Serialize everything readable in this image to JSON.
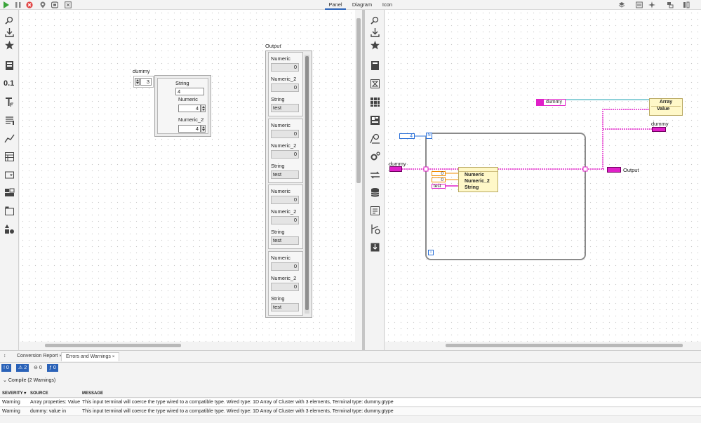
{
  "toolbar": {
    "tabs": [
      "Panel",
      "Diagram",
      "Icon"
    ],
    "active_tab": "Panel",
    "icons": [
      "run-icon",
      "pause-icon",
      "abort-icon",
      "breakpoint-icon",
      "probe-icon",
      "clean-up-icon"
    ]
  },
  "left_palette": {
    "icons": [
      "search-icon",
      "download-icon",
      "favorites-icon",
      "data-containers-icon",
      "numeric-icon",
      "string-icon",
      "list-icon",
      "graph-icon",
      "table-icon",
      "ring-icon",
      "boolean-icon",
      "tab-control-icon",
      "decorations-icon"
    ],
    "numeric_label": "0.1"
  },
  "right_palette": {
    "icons": [
      "search-icon",
      "download-icon",
      "favorites-icon",
      "data-icon",
      "timing-icon",
      "array-icon",
      "cluster-icon",
      "analysis-icon",
      "settings-icon",
      "comparison-icon",
      "database-icon",
      "report-icon",
      "connectivity-icon",
      "file-io-icon"
    ]
  },
  "panel": {
    "dummy": {
      "label": "dummy",
      "index": "3",
      "string_label": "String",
      "string_value": "4",
      "numeric_label": "Numeric",
      "numeric_value": "4",
      "numeric2_label": "Numeric_2",
      "numeric2_value": "4"
    },
    "output": {
      "label": "Output",
      "elements": [
        {
          "numeric_label": "Numeric",
          "numeric_value": "0",
          "numeric2_label": "Numeric_2",
          "numeric2_value": "0",
          "string_label": "String",
          "string_value": "test"
        },
        {
          "numeric_label": "Numeric",
          "numeric_value": "0",
          "numeric2_label": "Numeric_2",
          "numeric2_value": "0",
          "string_label": "String",
          "string_value": "test"
        },
        {
          "numeric_label": "Numeric",
          "numeric_value": "0",
          "numeric2_label": "Numeric_2",
          "numeric2_value": "0",
          "string_label": "String",
          "string_value": "test"
        },
        {
          "numeric_label": "Numeric",
          "numeric_value": "0",
          "numeric2_label": "Numeric_2",
          "numeric2_value": "0",
          "string_label": "String",
          "string_value": "test"
        }
      ]
    }
  },
  "diagram": {
    "dummy_ref_label": "dummy",
    "array_node": {
      "title": "Array",
      "property": "Value"
    },
    "dummy_indicator_label": "dummy",
    "loop_count": "4",
    "loop_n": "N",
    "loop_i": "i",
    "dummy_control_label": "dummy",
    "output_label": "Output",
    "bundle": {
      "fields": [
        "Numeric",
        "Numeric_2",
        "String"
      ]
    },
    "const_numeric": "0",
    "const_numeric2": "0",
    "const_string": "test"
  },
  "bottom": {
    "tabs": [
      "Conversion Report",
      "Errors and Warnings"
    ],
    "active_tab": "Errors and Warnings",
    "badges": {
      "errors": "0",
      "warnings": "2",
      "messages": "0",
      "info": "0"
    },
    "group_title": "Compile (2 Warnings)",
    "columns": [
      "SEVERITY",
      "SOURCE",
      "MESSAGE"
    ],
    "rows": [
      {
        "severity": "Warning",
        "source": "Array properties: Value",
        "message": "This input terminal will coerce the type wired to a compatible type. Wired type: 1D Array of Cluster with 3 elements, Terminal type: dummy.gtype"
      },
      {
        "severity": "Warning",
        "source": "dummy: value in",
        "message": "This input terminal will coerce the type wired to a compatible type. Wired type: 1D Array of Cluster with 3 elements, Terminal type: dummy.gtype"
      }
    ]
  },
  "colors": {
    "accent": "#2a62b8",
    "cluster_wire": "#e020c8",
    "numeric_wire": "#2a70d8",
    "i32_const": "#f08c00",
    "string_const": "#e020c8"
  }
}
